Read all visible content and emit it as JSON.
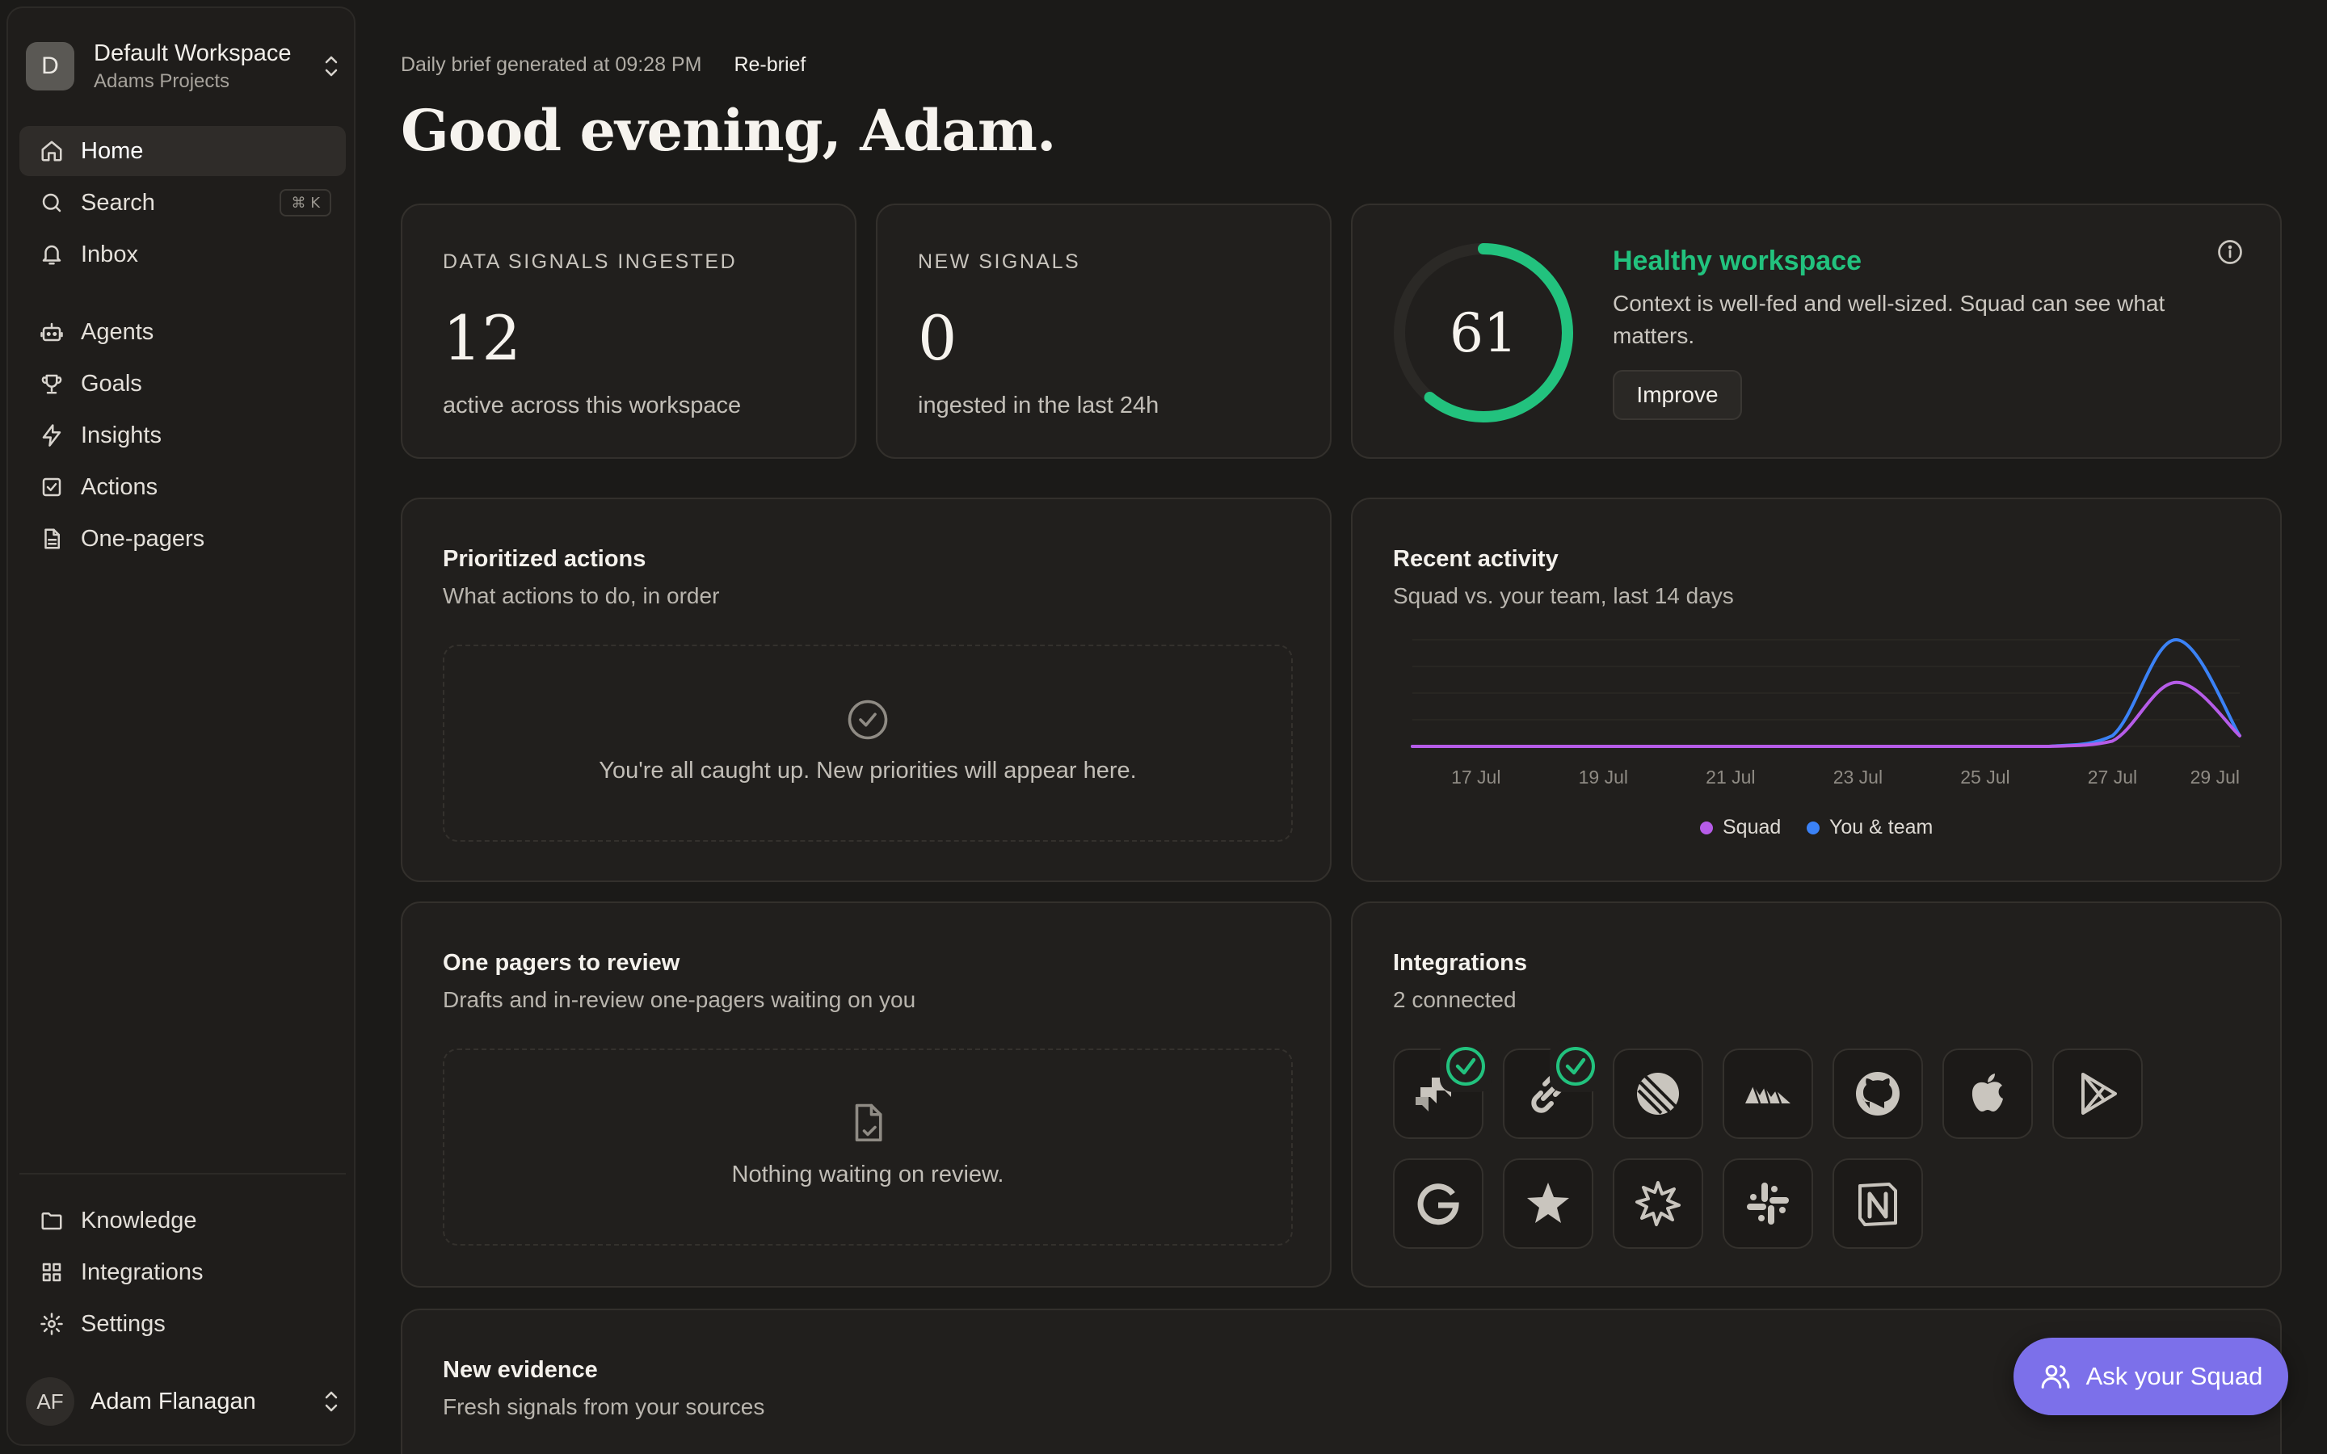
{
  "workspace": {
    "avatar_letter": "D",
    "name": "Default Workspace",
    "project": "Adams Projects"
  },
  "nav": {
    "primary": [
      {
        "label": "Home",
        "icon": "home-icon",
        "active": true
      },
      {
        "label": "Search",
        "icon": "search-icon",
        "shortcut": "⌘ K"
      },
      {
        "label": "Inbox",
        "icon": "bell-icon"
      }
    ],
    "secondary": [
      {
        "label": "Agents",
        "icon": "robot-icon"
      },
      {
        "label": "Goals",
        "icon": "trophy-icon"
      },
      {
        "label": "Insights",
        "icon": "lightning-icon"
      },
      {
        "label": "Actions",
        "icon": "checkbox-icon"
      },
      {
        "label": "One-pagers",
        "icon": "document-icon"
      }
    ],
    "bottom": [
      {
        "label": "Knowledge",
        "icon": "folder-icon"
      },
      {
        "label": "Integrations",
        "icon": "grid-icon"
      },
      {
        "label": "Settings",
        "icon": "gear-icon"
      }
    ]
  },
  "user": {
    "initials": "AF",
    "name": "Adam Flanagan"
  },
  "header": {
    "brief_text": "Daily brief generated at 09:28 PM",
    "rebrief_label": "Re-brief",
    "greeting": "Good evening, Adam."
  },
  "stats": {
    "signals": {
      "label": "DATA SIGNALS INGESTED",
      "value": "12",
      "sub": "active across this workspace"
    },
    "new_signals": {
      "label": "NEW SIGNALS",
      "value": "0",
      "sub": "ingested in the last 24h"
    }
  },
  "health": {
    "score": 61,
    "score_text": "61",
    "title": "Healthy workspace",
    "description": "Context is well-fed and well-sized. Squad can see what matters.",
    "improve_label": "Improve",
    "color": "#22c27e"
  },
  "prioritized": {
    "title": "Prioritized actions",
    "subtitle": "What actions to do, in order",
    "empty": "You're all caught up. New priorities will appear here."
  },
  "activity": {
    "title": "Recent activity",
    "subtitle": "Squad vs. your team, last 14 days"
  },
  "chart_data": {
    "type": "line",
    "x": [
      "16 Jul",
      "17 Jul",
      "18 Jul",
      "19 Jul",
      "20 Jul",
      "21 Jul",
      "22 Jul",
      "23 Jul",
      "24 Jul",
      "25 Jul",
      "26 Jul",
      "27 Jul",
      "28 Jul",
      "29 Jul"
    ],
    "tick_labels": [
      "17 Jul",
      "19 Jul",
      "21 Jul",
      "23 Jul",
      "25 Jul",
      "27 Jul",
      "29 Jul"
    ],
    "series": [
      {
        "name": "Squad",
        "color": "#b65ce8",
        "values": [
          0,
          0,
          0,
          0,
          0,
          0,
          0,
          0,
          0,
          0,
          0,
          0.5,
          6,
          1
        ]
      },
      {
        "name": "You & team",
        "color": "#3b82f6",
        "values": [
          0,
          0,
          0,
          0,
          0,
          0,
          0,
          0,
          0,
          0,
          0,
          1,
          10,
          1
        ]
      }
    ],
    "ylim": [
      0,
      10
    ],
    "grid": true,
    "legend": "bottom"
  },
  "onepagers": {
    "title": "One pagers to review",
    "subtitle": "Drafts and in-review one-pagers waiting on you",
    "empty": "Nothing waiting on review."
  },
  "integrations": {
    "title": "Integrations",
    "subtitle": "2 connected",
    "items": [
      {
        "icon": "jira-icon",
        "connected": true
      },
      {
        "icon": "chain-link-icon",
        "connected": true
      },
      {
        "icon": "linear-icon",
        "connected": false
      },
      {
        "icon": "cloud-icon",
        "connected": false
      },
      {
        "icon": "github-icon",
        "connected": false
      },
      {
        "icon": "apple-icon",
        "connected": false
      },
      {
        "icon": "google-play-icon",
        "connected": false
      },
      {
        "icon": "google-icon",
        "connected": false
      },
      {
        "icon": "star-icon",
        "connected": false
      },
      {
        "icon": "burst-icon",
        "connected": false
      },
      {
        "icon": "slack-icon",
        "connected": false
      },
      {
        "icon": "notion-icon",
        "connected": false
      }
    ]
  },
  "evidence": {
    "title": "New evidence",
    "subtitle": "Fresh signals from your sources"
  },
  "ask": {
    "label": "Ask your Squad"
  }
}
